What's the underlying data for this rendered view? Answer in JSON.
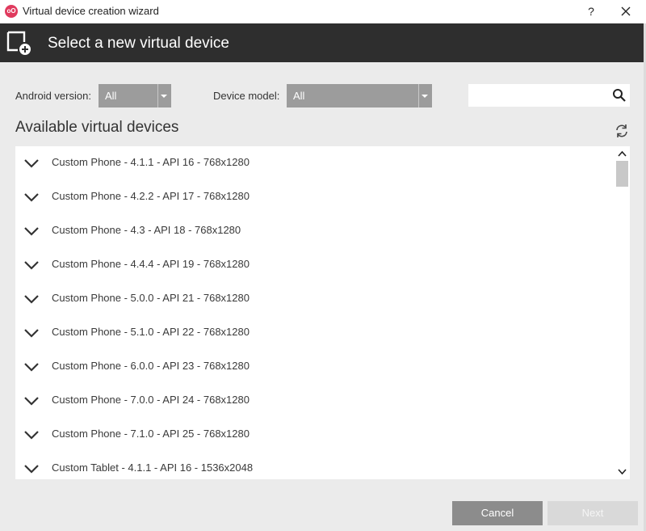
{
  "window": {
    "title": "Virtual device creation wizard",
    "help_label": "?",
    "app_icon_text": "oO"
  },
  "header": {
    "title": "Select a new virtual device"
  },
  "filters": {
    "android_version_label": "Android version:",
    "android_version_value": "All",
    "device_model_label": "Device model:",
    "device_model_value": "All",
    "search_value": ""
  },
  "list": {
    "title": "Available virtual devices",
    "devices": [
      "Custom Phone - 4.1.1 - API 16 - 768x1280",
      "Custom Phone - 4.2.2 - API 17 - 768x1280",
      "Custom Phone - 4.3 - API 18 - 768x1280",
      "Custom Phone - 4.4.4 - API 19 - 768x1280",
      "Custom Phone - 5.0.0 - API 21 - 768x1280",
      "Custom Phone - 5.1.0 - API 22 - 768x1280",
      "Custom Phone - 6.0.0 - API 23 - 768x1280",
      "Custom Phone - 7.0.0 - API 24 - 768x1280",
      "Custom Phone - 7.1.0 - API 25 - 768x1280",
      "Custom Tablet - 4.1.1 - API 16 - 1536x2048"
    ]
  },
  "footer": {
    "cancel_label": "Cancel",
    "next_label": "Next"
  },
  "colors": {
    "header_bg": "#2e2e2e",
    "select_bg": "#9c9c9c",
    "cancel_bg": "#8c8c8c",
    "next_disabled_bg": "#d9d9d9",
    "brand": "#e03a5e"
  }
}
